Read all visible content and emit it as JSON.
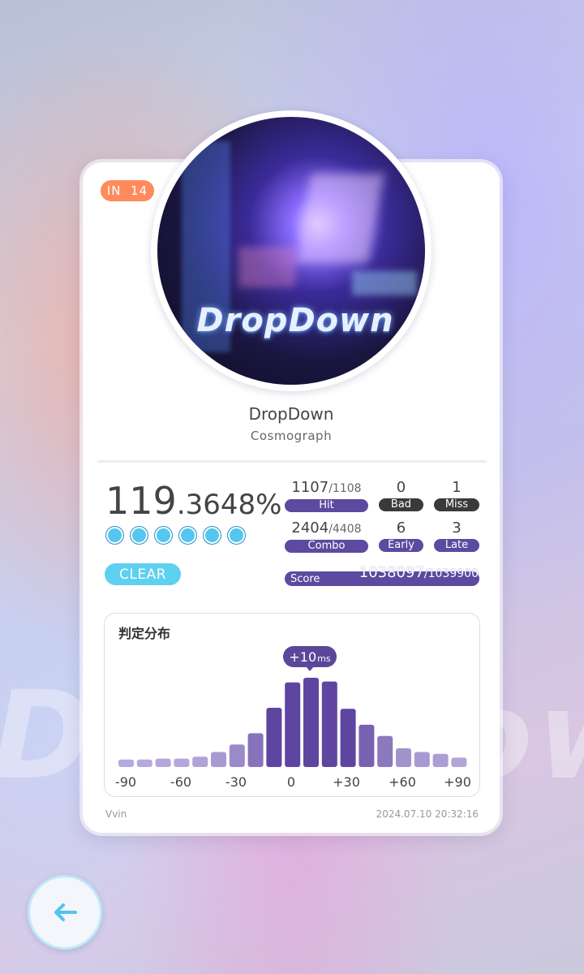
{
  "chart": {
    "difficulty": "IN",
    "level": "14"
  },
  "song": {
    "title": "DropDown",
    "artist": "Cosmograph",
    "jacket_text": "DropDown"
  },
  "result": {
    "accuracy_int": "119",
    "accuracy_dec": ".3648%",
    "rank_dots": 6,
    "status": "CLEAR",
    "hit": {
      "value": "1107",
      "total": "/1108",
      "label": "Hit"
    },
    "bad": {
      "value": "0",
      "label": "Bad"
    },
    "miss": {
      "value": "1",
      "label": "Miss"
    },
    "combo": {
      "value": "2404",
      "total": "/4408",
      "label": "Combo"
    },
    "early": {
      "value": "6",
      "label": "Early"
    },
    "late": {
      "value": "3",
      "label": "Late"
    },
    "score": {
      "label": "Score",
      "value": "1038097",
      "total": "/1039900"
    }
  },
  "distribution": {
    "title": "判定分布",
    "offset_value": "+10",
    "offset_unit": "ms",
    "tick_labels": [
      "-90",
      "-60",
      "-30",
      "0",
      "+30",
      "+60",
      "+90"
    ]
  },
  "chart_data": {
    "type": "bar",
    "title": "判定分布",
    "x": [
      -90,
      -80,
      -70,
      -60,
      -50,
      -40,
      -30,
      -20,
      -10,
      0,
      10,
      20,
      30,
      40,
      50,
      60,
      70,
      80,
      90
    ],
    "values": [
      8,
      8,
      9,
      9,
      11,
      16,
      24,
      36,
      63,
      90,
      95,
      91,
      62,
      45,
      33,
      20,
      16,
      14,
      10
    ],
    "xticks": [
      "-90",
      "-60",
      "-30",
      "0",
      "+30",
      "+60",
      "+90"
    ],
    "mean_offset_ms": 10
  },
  "footer": {
    "player": "Vvin",
    "timestamp": "2024.07.10 20:32:16"
  },
  "nav": {
    "back_icon": "arrow-left-icon"
  },
  "colors": {
    "accent": "#5c4aa0",
    "clear": "#5ed0f0",
    "level": "#ff8a5c"
  }
}
